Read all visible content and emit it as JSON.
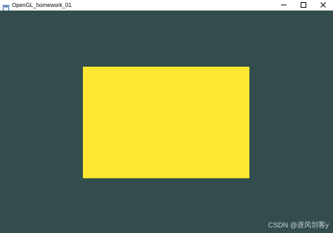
{
  "window": {
    "title": "OpenGL_homework_01",
    "icon": "opengl-app-icon"
  },
  "controls": {
    "minimize_icon": "minimize-icon",
    "maximize_icon": "maximize-icon",
    "close_icon": "close-icon"
  },
  "canvas": {
    "clear_color": "#334d4d",
    "shape": "rectangle",
    "shape_color": "#ffe633"
  },
  "watermark": {
    "text": "CSDN @逐风剑客y"
  }
}
